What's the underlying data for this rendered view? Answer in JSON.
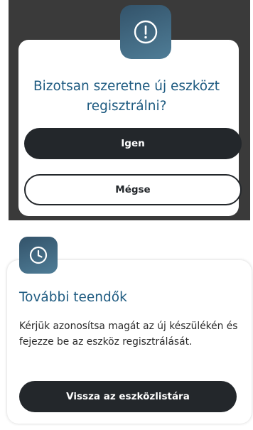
{
  "confirm_dialog": {
    "icon": "exclamation-circle-icon",
    "question": "Bizotsan szeretne új eszközt regisztrálni?",
    "yes_label": "Igen",
    "no_label": "Mégse"
  },
  "next_steps_card": {
    "icon": "clock-icon",
    "title": "További teendők",
    "body": "Kérjük azonosítsa magát az új készülékén és fejezze be az eszköz regisztrálását.",
    "back_label": "Vissza az eszközlistára"
  },
  "colors": {
    "title_blue": "#1d5a80",
    "button_dark": "#23272b",
    "backdrop": "#3a3a3a",
    "badge_gradient_start": "#33536a",
    "badge_gradient_end": "#4f7d97"
  }
}
